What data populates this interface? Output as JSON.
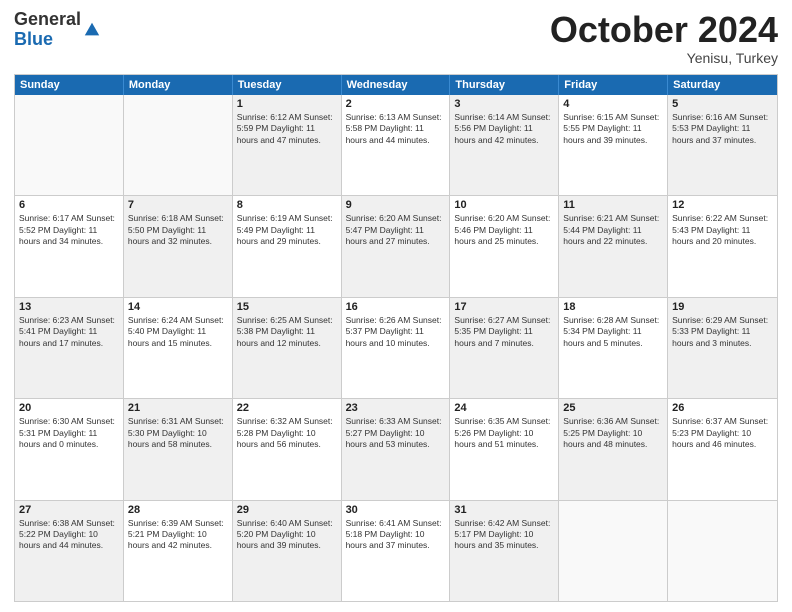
{
  "header": {
    "logo_line1": "General",
    "logo_line2": "Blue",
    "month": "October 2024",
    "location": "Yenisu, Turkey"
  },
  "weekdays": [
    "Sunday",
    "Monday",
    "Tuesday",
    "Wednesday",
    "Thursday",
    "Friday",
    "Saturday"
  ],
  "rows": [
    [
      {
        "day": "",
        "text": "",
        "empty": true
      },
      {
        "day": "",
        "text": "",
        "empty": true
      },
      {
        "day": "1",
        "text": "Sunrise: 6:12 AM\nSunset: 5:59 PM\nDaylight: 11 hours and 47 minutes."
      },
      {
        "day": "2",
        "text": "Sunrise: 6:13 AM\nSunset: 5:58 PM\nDaylight: 11 hours and 44 minutes."
      },
      {
        "day": "3",
        "text": "Sunrise: 6:14 AM\nSunset: 5:56 PM\nDaylight: 11 hours and 42 minutes."
      },
      {
        "day": "4",
        "text": "Sunrise: 6:15 AM\nSunset: 5:55 PM\nDaylight: 11 hours and 39 minutes."
      },
      {
        "day": "5",
        "text": "Sunrise: 6:16 AM\nSunset: 5:53 PM\nDaylight: 11 hours and 37 minutes."
      }
    ],
    [
      {
        "day": "6",
        "text": "Sunrise: 6:17 AM\nSunset: 5:52 PM\nDaylight: 11 hours and 34 minutes."
      },
      {
        "day": "7",
        "text": "Sunrise: 6:18 AM\nSunset: 5:50 PM\nDaylight: 11 hours and 32 minutes."
      },
      {
        "day": "8",
        "text": "Sunrise: 6:19 AM\nSunset: 5:49 PM\nDaylight: 11 hours and 29 minutes."
      },
      {
        "day": "9",
        "text": "Sunrise: 6:20 AM\nSunset: 5:47 PM\nDaylight: 11 hours and 27 minutes."
      },
      {
        "day": "10",
        "text": "Sunrise: 6:20 AM\nSunset: 5:46 PM\nDaylight: 11 hours and 25 minutes."
      },
      {
        "day": "11",
        "text": "Sunrise: 6:21 AM\nSunset: 5:44 PM\nDaylight: 11 hours and 22 minutes."
      },
      {
        "day": "12",
        "text": "Sunrise: 6:22 AM\nSunset: 5:43 PM\nDaylight: 11 hours and 20 minutes."
      }
    ],
    [
      {
        "day": "13",
        "text": "Sunrise: 6:23 AM\nSunset: 5:41 PM\nDaylight: 11 hours and 17 minutes."
      },
      {
        "day": "14",
        "text": "Sunrise: 6:24 AM\nSunset: 5:40 PM\nDaylight: 11 hours and 15 minutes."
      },
      {
        "day": "15",
        "text": "Sunrise: 6:25 AM\nSunset: 5:38 PM\nDaylight: 11 hours and 12 minutes."
      },
      {
        "day": "16",
        "text": "Sunrise: 6:26 AM\nSunset: 5:37 PM\nDaylight: 11 hours and 10 minutes."
      },
      {
        "day": "17",
        "text": "Sunrise: 6:27 AM\nSunset: 5:35 PM\nDaylight: 11 hours and 7 minutes."
      },
      {
        "day": "18",
        "text": "Sunrise: 6:28 AM\nSunset: 5:34 PM\nDaylight: 11 hours and 5 minutes."
      },
      {
        "day": "19",
        "text": "Sunrise: 6:29 AM\nSunset: 5:33 PM\nDaylight: 11 hours and 3 minutes."
      }
    ],
    [
      {
        "day": "20",
        "text": "Sunrise: 6:30 AM\nSunset: 5:31 PM\nDaylight: 11 hours and 0 minutes."
      },
      {
        "day": "21",
        "text": "Sunrise: 6:31 AM\nSunset: 5:30 PM\nDaylight: 10 hours and 58 minutes."
      },
      {
        "day": "22",
        "text": "Sunrise: 6:32 AM\nSunset: 5:28 PM\nDaylight: 10 hours and 56 minutes."
      },
      {
        "day": "23",
        "text": "Sunrise: 6:33 AM\nSunset: 5:27 PM\nDaylight: 10 hours and 53 minutes."
      },
      {
        "day": "24",
        "text": "Sunrise: 6:35 AM\nSunset: 5:26 PM\nDaylight: 10 hours and 51 minutes."
      },
      {
        "day": "25",
        "text": "Sunrise: 6:36 AM\nSunset: 5:25 PM\nDaylight: 10 hours and 48 minutes."
      },
      {
        "day": "26",
        "text": "Sunrise: 6:37 AM\nSunset: 5:23 PM\nDaylight: 10 hours and 46 minutes."
      }
    ],
    [
      {
        "day": "27",
        "text": "Sunrise: 6:38 AM\nSunset: 5:22 PM\nDaylight: 10 hours and 44 minutes."
      },
      {
        "day": "28",
        "text": "Sunrise: 6:39 AM\nSunset: 5:21 PM\nDaylight: 10 hours and 42 minutes."
      },
      {
        "day": "29",
        "text": "Sunrise: 6:40 AM\nSunset: 5:20 PM\nDaylight: 10 hours and 39 minutes."
      },
      {
        "day": "30",
        "text": "Sunrise: 6:41 AM\nSunset: 5:18 PM\nDaylight: 10 hours and 37 minutes."
      },
      {
        "day": "31",
        "text": "Sunrise: 6:42 AM\nSunset: 5:17 PM\nDaylight: 10 hours and 35 minutes."
      },
      {
        "day": "",
        "text": "",
        "empty": true
      },
      {
        "day": "",
        "text": "",
        "empty": true
      }
    ]
  ]
}
